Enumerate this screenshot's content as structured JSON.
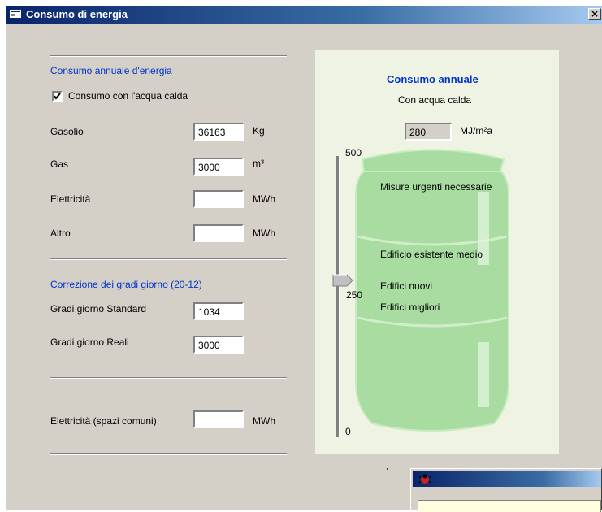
{
  "window": {
    "title": "Consumo di energia",
    "close_glyph": "×"
  },
  "annual": {
    "section_title": "Consumo annuale d'energia",
    "hot_water_checkbox": {
      "label": "Consumo con l'acqua calda",
      "checked": true
    },
    "rows": [
      {
        "label": "Gasolio",
        "value": "36163",
        "unit": "Kg"
      },
      {
        "label": "Gas",
        "value": "3000",
        "unit": "m³"
      },
      {
        "label": "Elettricità",
        "value": "",
        "unit": "MWh"
      },
      {
        "label": "Altro",
        "value": "",
        "unit": "MWh"
      }
    ]
  },
  "degree_days": {
    "section_title": "Correzione dei gradi giorno (20-12)",
    "standard": {
      "label": "Gradi giorno Standard",
      "value": "1034"
    },
    "real": {
      "label": "Gradi giorno Reali",
      "value": "3000"
    }
  },
  "common_electricity": {
    "label": "Elettricità (spazi comuni)",
    "value": "",
    "unit": "MWh"
  },
  "gauge": {
    "title": "Consumo annuale",
    "subtitle": "Con acqua calda",
    "value": "280",
    "unit": "MJ/m²a",
    "scale_top": "500",
    "scale_mid": "250",
    "scale_bottom": "0",
    "slider_value": 280,
    "levels": [
      "Misure urgenti necessarie",
      "Edificio esistente medio",
      "Edifici nuovi",
      "Edifici migliori"
    ]
  },
  "colors": {
    "title_bar": "#0a246a",
    "section_title": "#0033cc",
    "barrel": "#a8dca0",
    "panel_bg": "#eef3e4"
  }
}
